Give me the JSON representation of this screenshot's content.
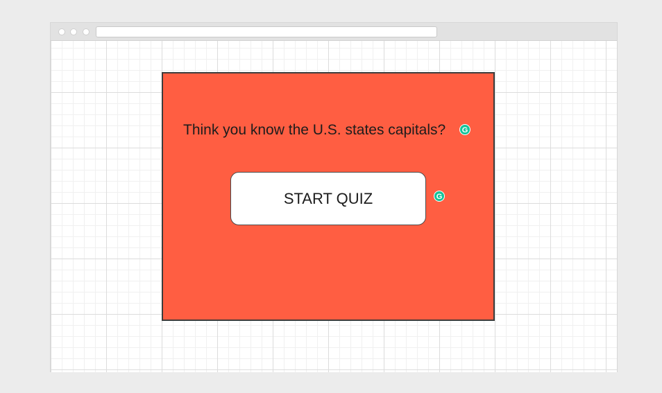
{
  "quiz": {
    "headline": "Think you know the U.S. states capitals?",
    "start_button_label": "START QUIZ",
    "card_color": "#ff5e42"
  },
  "extensions": {
    "grammar_badge_icon": "grammarly-g-icon",
    "grammar_badge_glyph": "G",
    "grammar_badge_color": "#15c39a"
  }
}
